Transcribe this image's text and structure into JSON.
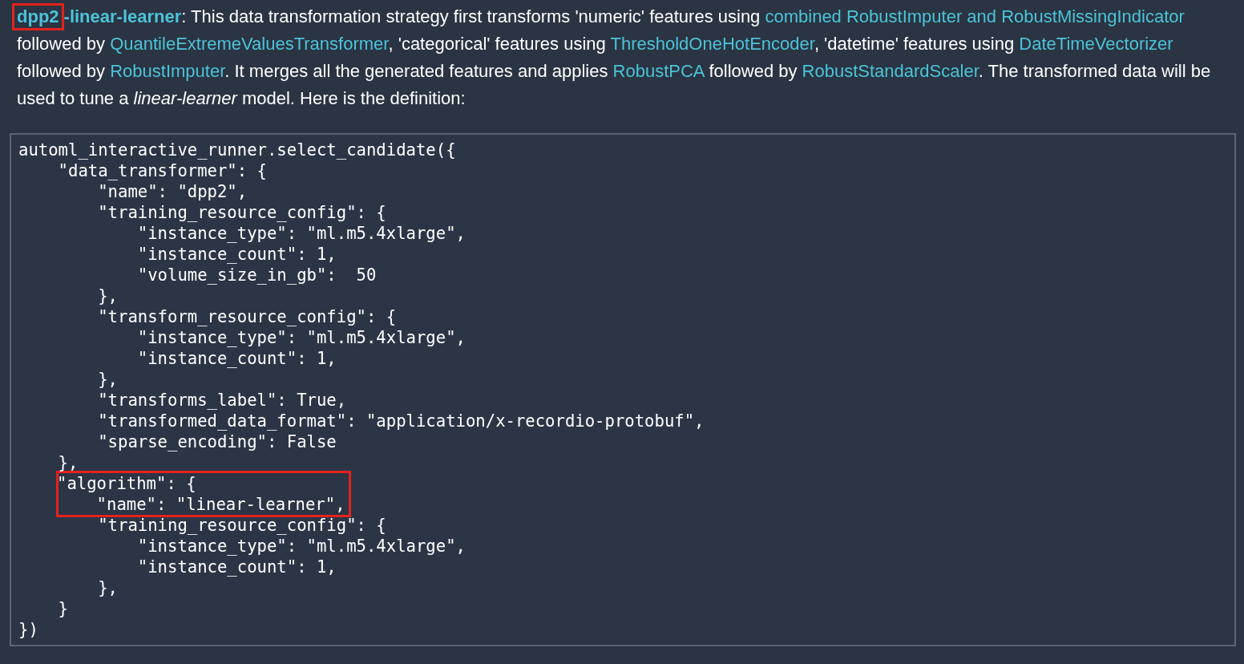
{
  "description": {
    "segments": [
      {
        "kind": "title",
        "text": "dpp2",
        "highlighted": true
      },
      {
        "kind": "title",
        "text": "-linear-learner",
        "highlighted": false
      },
      {
        "kind": "text",
        "text": ": This data transformation strategy first transforms 'numeric' features using "
      },
      {
        "kind": "link",
        "text": "combined RobustImputer and RobustMissingIndicator"
      },
      {
        "kind": "text",
        "text": " followed by "
      },
      {
        "kind": "link",
        "text": "QuantileExtremeValuesTransformer"
      },
      {
        "kind": "text",
        "text": ", 'categorical' features using "
      },
      {
        "kind": "link",
        "text": "ThresholdOneHotEncoder"
      },
      {
        "kind": "text",
        "text": ", 'datetime' features using "
      },
      {
        "kind": "link",
        "text": "DateTimeVectorizer"
      },
      {
        "kind": "text",
        "text": " followed by "
      },
      {
        "kind": "link",
        "text": "RobustImputer"
      },
      {
        "kind": "text",
        "text": ". It merges all the generated features and applies "
      },
      {
        "kind": "link",
        "text": "RobustPCA"
      },
      {
        "kind": "text",
        "text": " followed by "
      },
      {
        "kind": "link",
        "text": "RobustStandardScaler"
      },
      {
        "kind": "text",
        "text": ". The transformed data will be used to tune a "
      },
      {
        "kind": "em",
        "text": "linear-learner"
      },
      {
        "kind": "text",
        "text": " model. Here is the definition:"
      }
    ]
  },
  "code": {
    "lines": [
      {
        "text": "automl_interactive_runner.select_candidate({",
        "highlighted": false
      },
      {
        "text": "    \"data_transformer\": {",
        "highlighted": false
      },
      {
        "text": "        \"name\": \"dpp2\",",
        "highlighted": false
      },
      {
        "text": "        \"training_resource_config\": {",
        "highlighted": false
      },
      {
        "text": "            \"instance_type\": \"ml.m5.4xlarge\",",
        "highlighted": false
      },
      {
        "text": "            \"instance_count\": 1,",
        "highlighted": false
      },
      {
        "text": "            \"volume_size_in_gb\":  50",
        "highlighted": false
      },
      {
        "text": "        },",
        "highlighted": false
      },
      {
        "text": "        \"transform_resource_config\": {",
        "highlighted": false
      },
      {
        "text": "            \"instance_type\": \"ml.m5.4xlarge\",",
        "highlighted": false
      },
      {
        "text": "            \"instance_count\": 1,",
        "highlighted": false
      },
      {
        "text": "        },",
        "highlighted": false
      },
      {
        "text": "        \"transforms_label\": True,",
        "highlighted": false
      },
      {
        "text": "        \"transformed_data_format\": \"application/x-recordio-protobuf\",",
        "highlighted": false
      },
      {
        "text": "        \"sparse_encoding\": False",
        "highlighted": false
      },
      {
        "text": "    },",
        "highlighted": false
      },
      {
        "text": "    \"algorithm\": {",
        "highlighted": true
      },
      {
        "text": "        \"name\": \"linear-learner\",",
        "highlighted": true
      },
      {
        "text": "        \"training_resource_config\": {",
        "highlighted": false
      },
      {
        "text": "            \"instance_type\": \"ml.m5.4xlarge\",",
        "highlighted": false
      },
      {
        "text": "            \"instance_count\": 1,",
        "highlighted": false
      },
      {
        "text": "        },",
        "highlighted": false
      },
      {
        "text": "    }",
        "highlighted": false
      },
      {
        "text": "})",
        "highlighted": false
      }
    ]
  }
}
